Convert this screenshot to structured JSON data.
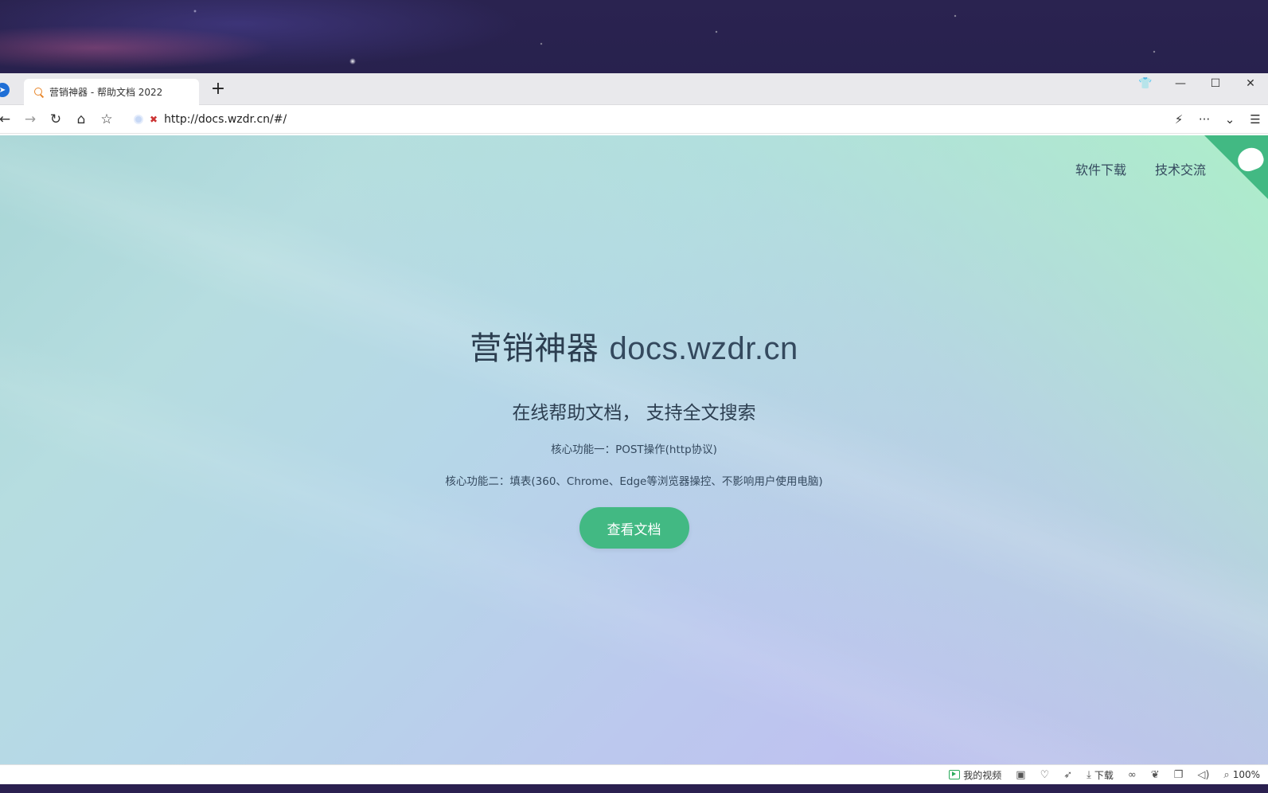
{
  "browser": {
    "tab": {
      "title": "营销神器 - 帮助文档 2022",
      "new_tab_symbol": "+"
    },
    "address": {
      "url": "http://docs.wzdr.cn/#/"
    },
    "window_controls": {
      "skin": "👕",
      "minimize": "—",
      "maximize": "☐",
      "close": "✕"
    },
    "nav": {
      "back": "←",
      "forward": "→",
      "reload": "↻",
      "home": "⌂",
      "favorites": "☆"
    },
    "toolbar_right": {
      "lightning": "⚡",
      "more": "···",
      "dropdown": "⌄",
      "menu": "☰"
    },
    "statusbar": {
      "my_video": "我的视频",
      "download": "下载",
      "zoom": "100%",
      "icons": [
        "image-icon",
        "heart-icon",
        "rocket-icon",
        "download-icon",
        "glasses-icon",
        "leaf-icon",
        "window-icon",
        "speaker-icon",
        "zoom-icon"
      ]
    }
  },
  "page": {
    "nav": {
      "software_download": "软件下载",
      "tech_exchange": "技术交流"
    },
    "hero": {
      "title_cn": "营销神器",
      "title_site": "docs.wzdr.cn",
      "subtitle": "在线帮助文档， 支持全文搜索",
      "feature1": "核心功能一：POST操作(http协议)",
      "feature2": "核心功能二：填表(360、Chrome、Edge等浏览器操控、不影响用户使用电脑)",
      "button": "查看文档"
    },
    "colors": {
      "accent": "#42b983",
      "text": "#2c3e50"
    }
  }
}
